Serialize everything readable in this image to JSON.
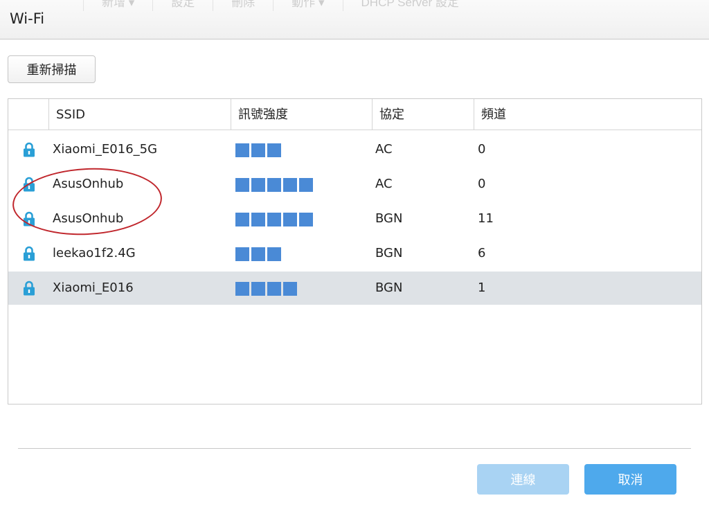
{
  "window": {
    "title": "Wi-Fi",
    "background_menu": [
      "新增 ▾",
      "設定",
      "刪除",
      "動作 ▾",
      "DHCP Server 設定"
    ]
  },
  "toolbar": {
    "rescan_label": "重新掃描"
  },
  "table": {
    "columns": [
      "SSID",
      "訊號強度",
      "協定",
      "頻道"
    ],
    "rows": [
      {
        "ssid": "Xiaomi_E016_5G",
        "signal_bars": 3,
        "protocol": "AC",
        "channel": "0",
        "secured": true,
        "selected": false
      },
      {
        "ssid": "AsusOnhub",
        "signal_bars": 5,
        "protocol": "AC",
        "channel": "0",
        "secured": true,
        "selected": false
      },
      {
        "ssid": "AsusOnhub",
        "signal_bars": 5,
        "protocol": "BGN",
        "channel": "11",
        "secured": true,
        "selected": false
      },
      {
        "ssid": "leekao1f2.4G",
        "signal_bars": 3,
        "protocol": "BGN",
        "channel": "6",
        "secured": true,
        "selected": false
      },
      {
        "ssid": "Xiaomi_E016",
        "signal_bars": 4,
        "protocol": "BGN",
        "channel": "1",
        "secured": true,
        "selected": true
      }
    ]
  },
  "footer": {
    "connect_label": "連線",
    "cancel_label": "取消"
  },
  "colors": {
    "signal_bar": "#4a8ad6",
    "lock_icon": "#2a9fd6",
    "selected_row": "#dee2e6",
    "connect_disabled": "#a9d3f3",
    "cancel": "#4ea9ec",
    "annotation": "#c0262c"
  },
  "icons": {
    "lock": "lock-icon"
  }
}
